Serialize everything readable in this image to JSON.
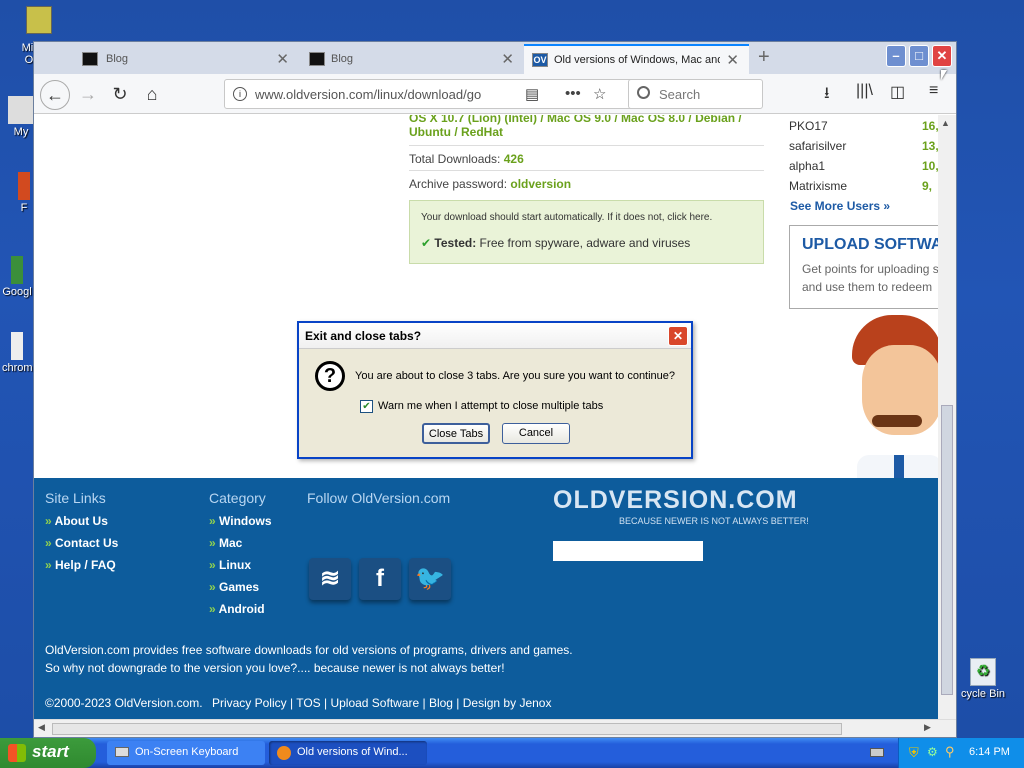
{
  "desktop": {
    "icons": [
      "Micr Ou",
      "My",
      "F",
      "Googl",
      "chrom"
    ],
    "recycle_bin": "cycle Bin"
  },
  "browser": {
    "tabs": [
      {
        "title": "Blog"
      },
      {
        "title": "Blog"
      },
      {
        "title": "Old versions of Windows, Mac and",
        "favicon": "OV"
      }
    ],
    "url": "www.oldversion.com/linux/download/go",
    "search_placeholder": "Search"
  },
  "page": {
    "compat_text": "OS X 10.7 (Lion) (Intel) / Mac OS 9.0 / Mac OS 8.0 / Debian / Ubuntu / RedHat",
    "total_downloads_label": "Total Downloads:",
    "total_downloads_value": "426",
    "archive_label": "Archive password:",
    "archive_value": "oldversion",
    "download_notice": "Your download should start automatically. If it does not, click here.",
    "tested_label": "Tested:",
    "tested_text": "Free from spyware, adware and viruses",
    "users": [
      {
        "name": "PKO17",
        "count": "16,"
      },
      {
        "name": "safarisilver",
        "count": "13,"
      },
      {
        "name": "alpha1",
        "count": "10,"
      },
      {
        "name": "Matrixisme",
        "count": "9,"
      }
    ],
    "see_more": "See More Users »",
    "upload_title": "UPLOAD SOFTWA",
    "upload_text": "Get points for uploading s and use them to redeem"
  },
  "footer": {
    "site_links_title": "Site Links",
    "site_links": [
      "About Us",
      "Contact Us",
      "Help / FAQ"
    ],
    "category_title": "Category",
    "categories": [
      "Windows",
      "Mac",
      "Linux",
      "Games",
      "Android"
    ],
    "follow_title": "Follow OldVersion.com",
    "logo": "OLDVERSION.COM",
    "tagline": "BECAUSE NEWER IS NOT ALWAYS BETTER!",
    "desc1": "OldVersion.com provides free software downloads for old versions of programs, drivers and games.",
    "desc2": "So why not downgrade to the version you love?.... because newer is not always better!",
    "copyright": "©2000-2023 OldVersion.com.",
    "links": "Privacy Policy | TOS | Upload Software | Blog | Design by Jenox"
  },
  "dialog": {
    "title": "Exit and close tabs?",
    "message": "You are about to close 3 tabs. Are you sure you want to continue?",
    "checkbox_label": "Warn me when I attempt to close multiple tabs",
    "checkbox_checked": true,
    "close_tabs": "Close Tabs",
    "cancel": "Cancel"
  },
  "taskbar": {
    "start": "start",
    "tasks": [
      "On-Screen Keyboard",
      "Old versions of Wind..."
    ],
    "clock": "6:14 PM"
  }
}
